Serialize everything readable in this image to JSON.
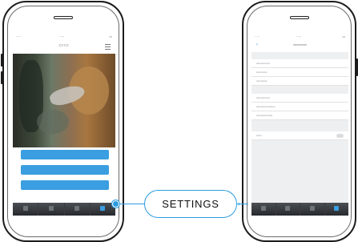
{
  "callout": {
    "label": "SETTINGS"
  },
  "colors": {
    "accent": "#2b9be0",
    "button_blue": "#3a9ee0",
    "phone_frame": "#1c1c1c",
    "tab_bar": "#2f3337"
  },
  "left_phone": {
    "screen": "live-view",
    "camera_buttons": 3,
    "tab_count": 4,
    "active_tab": 4
  },
  "right_phone": {
    "screen": "settings",
    "tab_count": 4,
    "active_tab": 4,
    "toggle_count": 1
  }
}
